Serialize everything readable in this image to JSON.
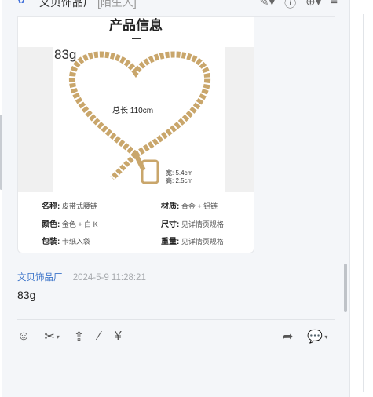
{
  "header": {
    "name": "文贝饰品厂",
    "tag": "[陌生人]"
  },
  "card": {
    "title": "产品信息",
    "weight": "83g",
    "length": "总长 110cm",
    "width": "宽: 5.4cm",
    "height": "高: 2.5cm",
    "specs": [
      {
        "label": "名称:",
        "value": "皮带式腰链"
      },
      {
        "label": "材质:",
        "value": "合金 + 铝链"
      },
      {
        "label": "颜色:",
        "value": "金色 + 白 K"
      },
      {
        "label": "尺寸:",
        "value": "见详情页规格"
      },
      {
        "label": "包装:",
        "value": "卡纸入袋"
      },
      {
        "label": "重量:",
        "value": "见详情页规格"
      }
    ]
  },
  "message": {
    "sender": "文贝饰品厂",
    "time": "2024-5-9 11:28:21",
    "text": "83g"
  },
  "toolbar": {
    "left": [
      "emoji-icon",
      "scissors-icon",
      "upload-icon",
      "calculator-icon",
      "invoice-icon"
    ],
    "right": [
      "share-icon",
      "quick-reply-icon"
    ]
  }
}
